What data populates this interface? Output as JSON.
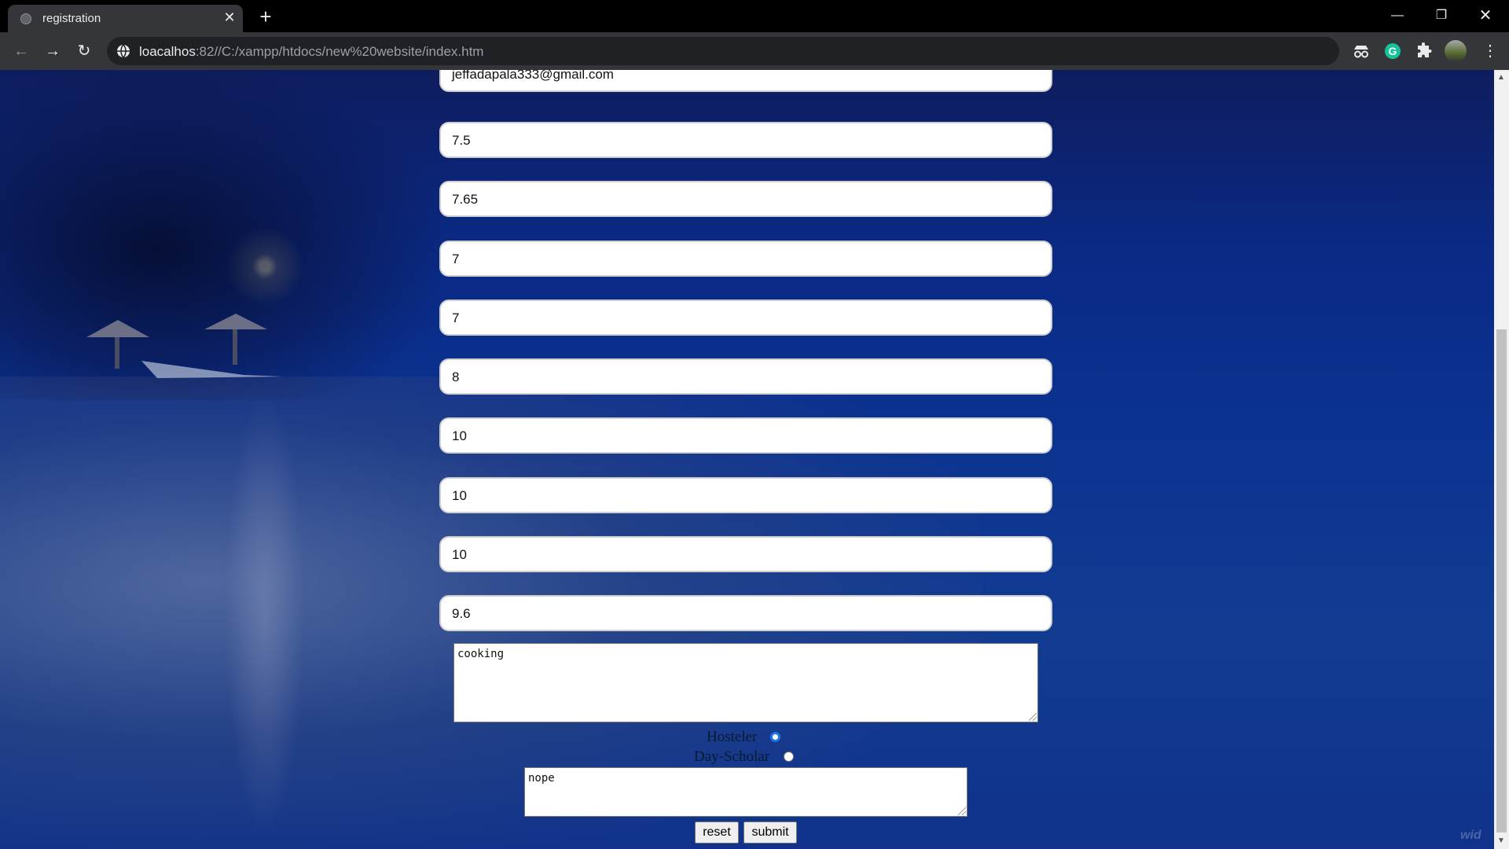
{
  "browser": {
    "tab_title": "registration",
    "url_host": "loacalhos",
    "url_rest": ":82//C:/xampp/htdocs/new%20website/index.htm",
    "extension_letter": "G"
  },
  "form": {
    "email": "jeffadapala333@gmail.com",
    "scores": [
      "7.5",
      "7.65",
      "7",
      "7",
      "8",
      "10",
      "10",
      "10",
      "9.6"
    ],
    "hobbies": "cooking",
    "residence_options": [
      "Hosteler",
      "Day-Scholar"
    ],
    "residence_selected": "Hosteler",
    "remarks": "nope",
    "reset_label": "reset",
    "submit_label": "submit"
  },
  "watermark": "wid",
  "colors": {
    "radio_accent": "#1a73e8",
    "page_background": "#0b3391"
  }
}
